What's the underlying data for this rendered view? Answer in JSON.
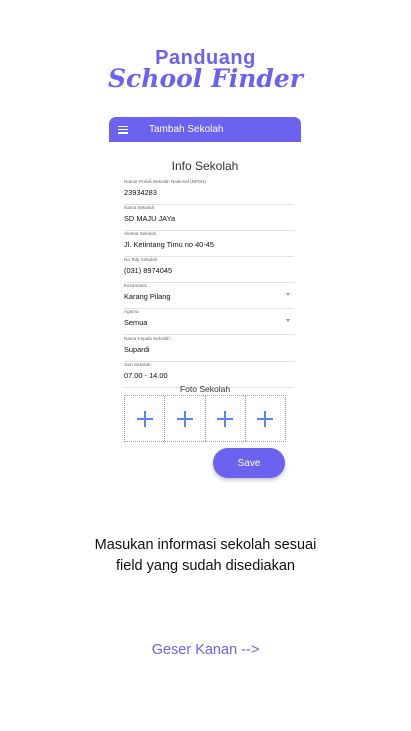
{
  "brand": {
    "line1": "Panduang",
    "line2": "School Finder",
    "color": "#6b63f0"
  },
  "phone": {
    "appbar": {
      "menu_icon": "hamburger-menu-icon",
      "title": "Tambah Sekolah"
    },
    "form_title": "Info Sekolah",
    "fields": [
      {
        "label": "Nomor Pokok Sekolah Nasional (NPSN)",
        "value": "23934283"
      },
      {
        "label": "Nama Sekolah",
        "value": "SD MAJU JAYa"
      },
      {
        "label": "Alamat Sekolah",
        "value": "Jl. Ketintang Timu no 40-45"
      },
      {
        "label": "No Telp Sekolah",
        "value": "(031) 8974045"
      },
      {
        "label": "Kecamatan",
        "value": "Karang Pilang"
      },
      {
        "label": "Agama",
        "value": "Semua"
      },
      {
        "label": "Nama Kepala Sekolah",
        "value": "Supardi"
      },
      {
        "label": "Jam Sekolah",
        "value": "07.00 - 14.00"
      }
    ],
    "photo_title": "Foto Sekolah",
    "photo_slots": [
      "plus-icon",
      "plus-icon",
      "plus-icon",
      "plus-icon"
    ],
    "save_label": "Save"
  },
  "description": {
    "line1": "Masukan informasi sekolah sesuai",
    "line2": "field yang sudah disediakan"
  },
  "swipe_hint": "Geser Kanan -->"
}
